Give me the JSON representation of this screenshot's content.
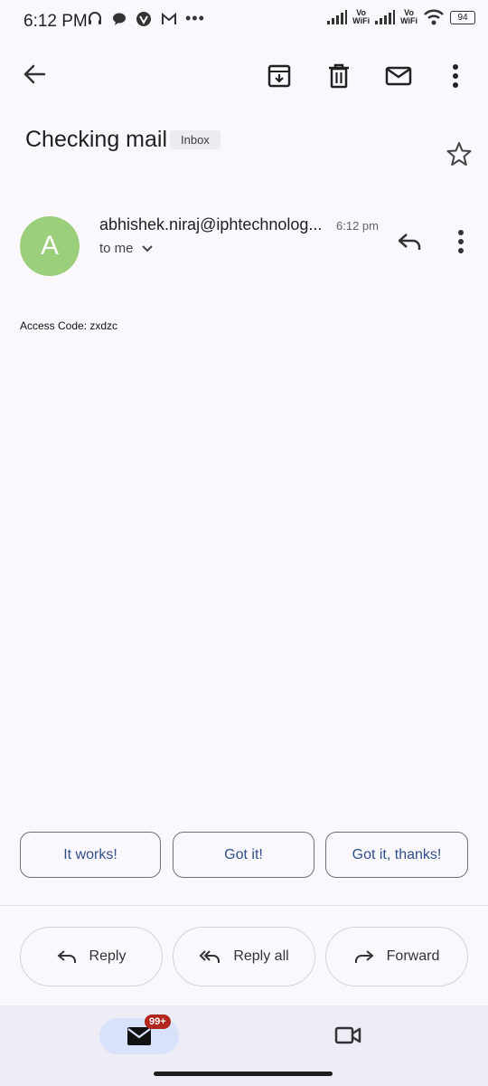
{
  "status_bar": {
    "time": "6:12 PM",
    "vo_wifi_1": "Vo\nWiFi",
    "vo_label": "Vo",
    "wifi_label": "WiFi",
    "battery": "94"
  },
  "toolbar": {
    "icons": [
      "back-arrow-icon",
      "archive-icon",
      "delete-icon",
      "mark-unread-icon",
      "more-vert-icon"
    ]
  },
  "email": {
    "subject": "Checking mail",
    "label": "Inbox",
    "sender_initial": "A",
    "sender": "abhishek.niraj@iphtechnolog...",
    "time": "6:12 pm",
    "recipient": "to me",
    "body": "Access Code: zxdzc"
  },
  "smart_replies": [
    "It works!",
    "Got it!",
    "Got it, thanks!"
  ],
  "actions": {
    "reply": "Reply",
    "reply_all": "Reply all",
    "forward": "Forward"
  },
  "bottom_nav": {
    "mail_badge": "99+",
    "colors": {
      "badge": "#b3261e",
      "pill": "#d9e2fb"
    }
  },
  "colors": {
    "avatar": "#9ccf7b",
    "chip_text": "#2f4f8a"
  }
}
